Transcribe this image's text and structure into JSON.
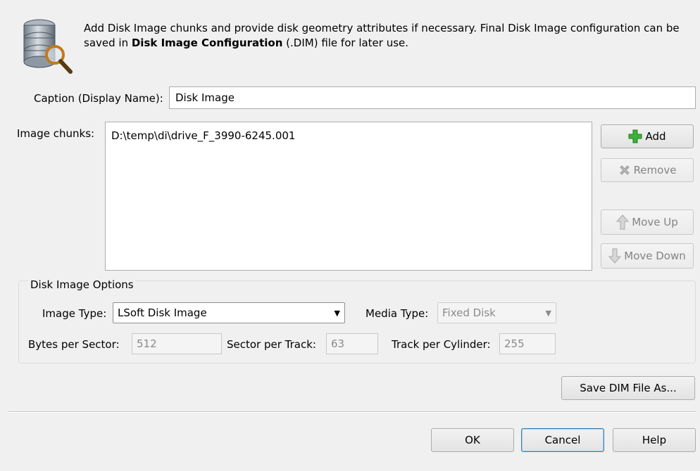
{
  "intro": {
    "text_before": "Add Disk Image chunks and provide disk geometry attributes if necessary. Final Disk Image configuration can be saved in ",
    "bold": "Disk Image Configuration",
    "text_after": " (.DIM) file for later use.",
    "icon": "database-search-icon"
  },
  "caption": {
    "label": "Caption (Display Name):",
    "value": "Disk Image"
  },
  "chunks": {
    "label": "Image chunks:",
    "items": [
      "D:\\temp\\di\\drive_F_3990-6245.001"
    ]
  },
  "buttons": {
    "add": "Add",
    "remove": "Remove",
    "move_up": "Move Up",
    "move_down": "Move Down",
    "save_dim": "Save DIM File As...",
    "ok": "OK",
    "cancel": "Cancel",
    "help": "Help"
  },
  "options": {
    "group_title": "Disk Image Options",
    "image_type_label": "Image Type:",
    "image_type_value": "LSoft Disk Image",
    "media_type_label": "Media Type:",
    "media_type_value": "Fixed Disk",
    "bytes_per_sector_label": "Bytes per Sector:",
    "bytes_per_sector_value": "512",
    "sector_per_track_label": "Sector per Track:",
    "sector_per_track_value": "63",
    "track_per_cylinder_label": "Track per Cylinder:",
    "track_per_cylinder_value": "255"
  },
  "colors": {
    "add_icon": "#3bb33b",
    "disabled_text": "#838383",
    "default_button_border": "#3c7fb1"
  }
}
